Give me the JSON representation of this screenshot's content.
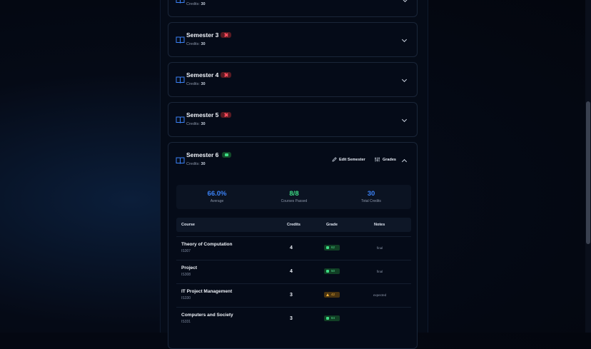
{
  "semesters": {
    "s2": {
      "credits_label": "Credits:",
      "credits": "30"
    },
    "s3": {
      "title": "Semester 3",
      "credits_label": "Credits:",
      "credits": "30"
    },
    "s4": {
      "title": "Semester 4",
      "credits_label": "Credits:",
      "credits": "30"
    },
    "s5": {
      "title": "Semester 5",
      "credits_label": "Credits:",
      "credits": "30"
    },
    "s6": {
      "title": "Semester 6",
      "credits_label": "Credits:",
      "credits": "30",
      "edit_label": "Edit Semester",
      "grades_label": "Grades"
    }
  },
  "stats": {
    "average": {
      "value": "66.0%",
      "label": "Average",
      "color": "#3b82f6"
    },
    "passed": {
      "value": "8/8",
      "label": "Courses Passed",
      "color": "#3ddc84"
    },
    "credits": {
      "value": "30",
      "label": "Total Credits",
      "color": "#3b82f6"
    }
  },
  "table": {
    "headers": {
      "course": "Course",
      "credits": "Credits",
      "grade": "Grade",
      "notes": "Notes"
    },
    "rows": [
      {
        "name": "Theory of Computation",
        "code": "IS307",
        "credits": "4",
        "grade": "62",
        "status": "green",
        "note": "final"
      },
      {
        "name": "Project",
        "code": "IS308",
        "credits": "4",
        "grade": "50",
        "status": "green",
        "note": "final"
      },
      {
        "name": "IT Project Management",
        "code": "IS330",
        "credits": "3",
        "grade": "42",
        "status": "amber",
        "note": "expected"
      },
      {
        "name": "Computers and Society",
        "code": "IS331",
        "credits": "3",
        "grade": "84",
        "status": "green",
        "note": ""
      }
    ]
  },
  "colors": {
    "accent_blue": "#3b82f6",
    "fail_red": "#ff4d5e",
    "pass_green": "#3ddc84",
    "warn_amber": "#f2b23a"
  }
}
